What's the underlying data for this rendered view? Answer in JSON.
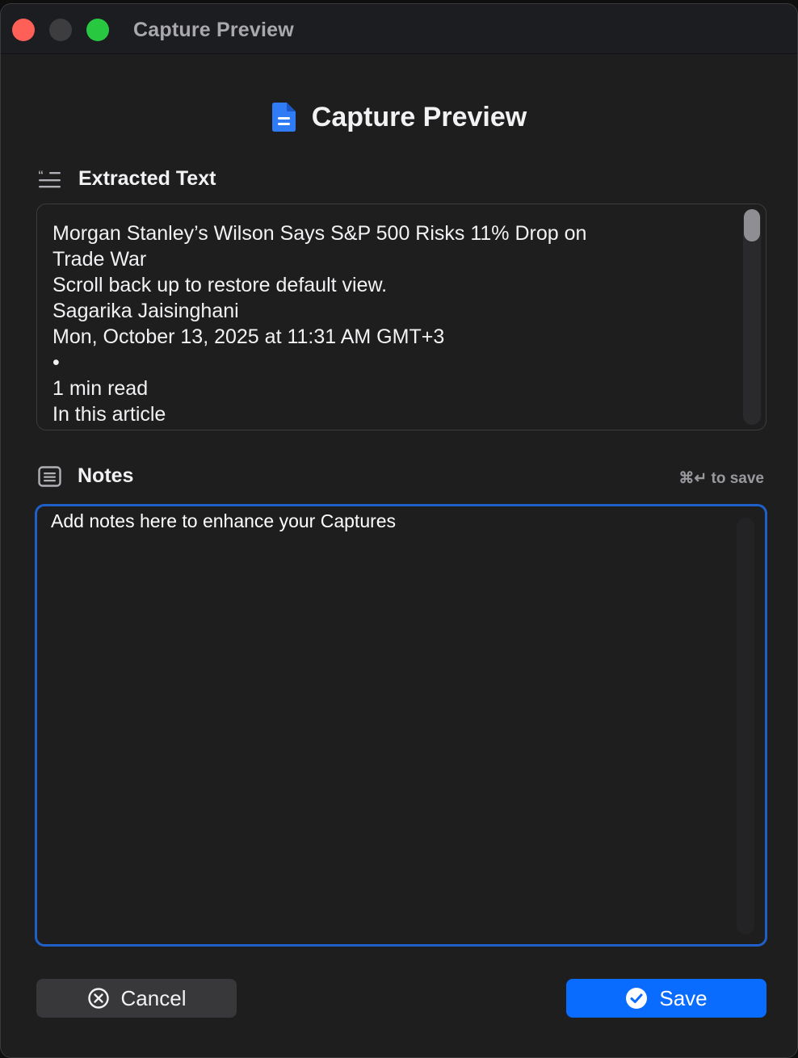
{
  "window": {
    "title": "Capture Preview"
  },
  "header": {
    "title": "Capture Preview",
    "icon": "document-icon"
  },
  "extracted_text": {
    "label": "Extracted Text",
    "icon": "quote-text-icon",
    "lines": [
      "Morgan Stanley’s Wilson Says S&P 500 Risks 11% Drop on",
      "Trade War",
      "Scroll back up to restore default view.",
      "Sagarika Jaisinghani",
      "Mon, October 13, 2025 at 11:31 AM GMT+3",
      "•",
      "1 min read",
      "In this article"
    ]
  },
  "notes": {
    "label": "Notes",
    "icon": "note-icon",
    "shortcut_hint": "⌘↵ to save",
    "placeholder": "Add notes here to enhance your Captures"
  },
  "buttons": {
    "cancel_label": "Cancel",
    "save_label": "Save"
  },
  "colors": {
    "accent": "#0a6cff",
    "focus_border": "#1f5fc8",
    "background": "#1e1e1f"
  }
}
